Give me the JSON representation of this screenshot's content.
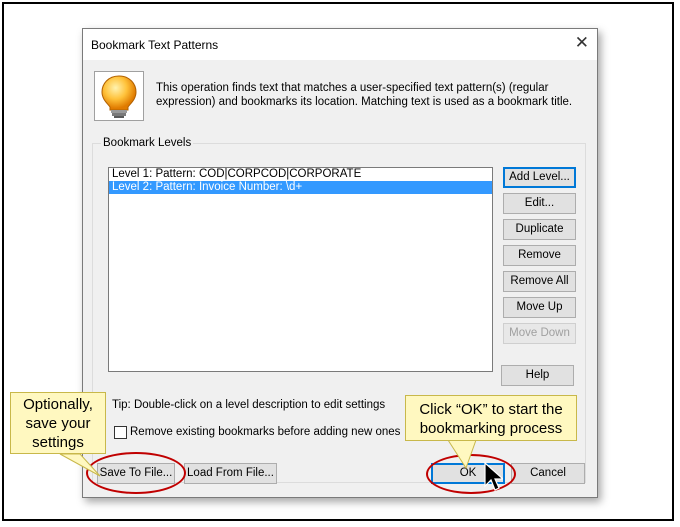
{
  "dialog": {
    "title": "Bookmark Text Patterns",
    "close_glyph": "✕",
    "icon": "lightbulb-icon",
    "description": "This operation finds text that matches a user-specified text pattern(s) (regular expression) and bookmarks its location. Matching text is used as a bookmark title.",
    "group_label": "Bookmark Levels",
    "levels": [
      {
        "text": "Level 1: Pattern: COD|CORPCOD|CORPORATE",
        "selected": false
      },
      {
        "text": "Level 2: Pattern: Invoice Number: \\d+",
        "selected": true
      }
    ],
    "buttons": {
      "add_level": "Add Level...",
      "edit": "Edit...",
      "duplicate": "Duplicate",
      "remove": "Remove",
      "remove_all": "Remove All",
      "move_up": "Move Up",
      "move_down": "Move Down",
      "help": "Help",
      "save_to_file": "Save To File...",
      "load_from_file": "Load From File...",
      "ok": "OK",
      "cancel": "Cancel"
    },
    "tip": "Tip: Double-click on a level description to edit settings",
    "remove_existing_label": "Remove existing bookmarks before adding new ones",
    "remove_existing_checked": false
  },
  "annotations": {
    "callout_left": "Optionally, save your settings",
    "callout_right": "Click “OK” to start the bookmarking process",
    "highlight_color": "#c00000",
    "callout_color": "#fff8c0"
  },
  "colors": {
    "selection": "#3399ff",
    "dialog_bg": "#f0f0f0"
  }
}
